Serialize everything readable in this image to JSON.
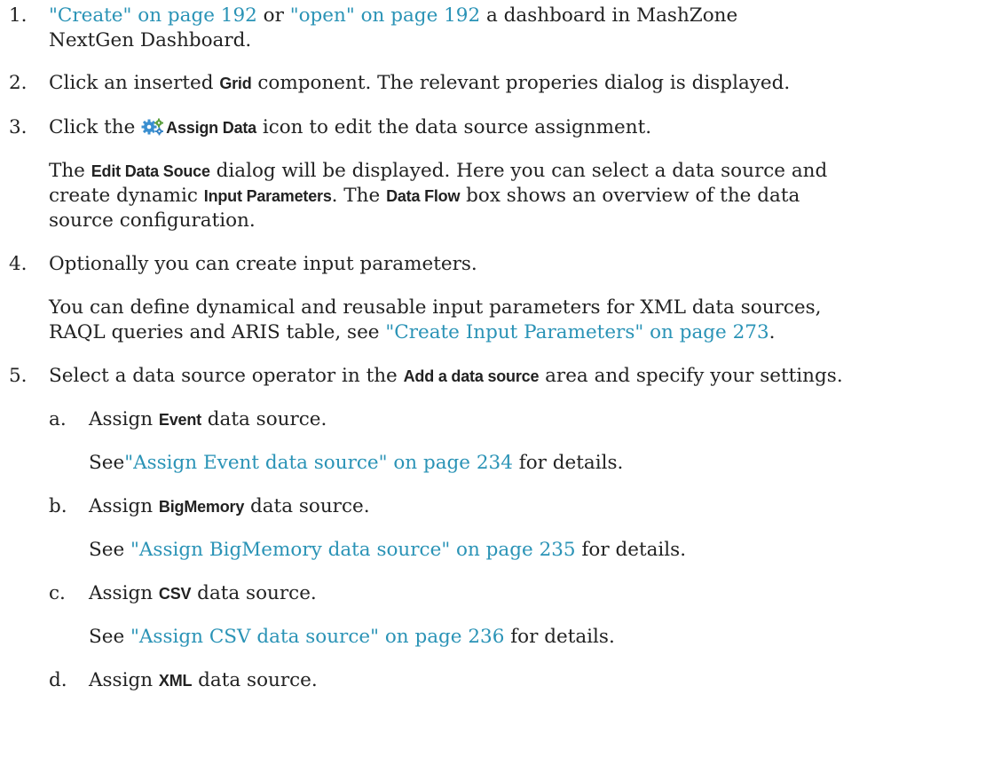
{
  "steps": [
    {
      "num": "1.",
      "create_link": "\"Create\" on page 192",
      "or": " or ",
      "open_link": "\"open\" on page 192",
      "text_end": " a dashboard in MashZone",
      "line2": "NextGen Dashboard."
    },
    {
      "num": "2.",
      "text_start": "Click an inserted ",
      "ui": "Grid",
      "text_end": " component. The relevant properies dialog is displayed."
    },
    {
      "num": "3.",
      "text_start": "Click the ",
      "icon_name": "assign-data-gear-icon",
      "ui": "Assign Data",
      "text_end": " icon to edit the data source assignment.",
      "para": {
        "l1_a": "The ",
        "l1_ui": "Edit Data Souce",
        "l1_b": " dialog will be displayed. Here you can select a data source and",
        "l2_a": "create dynamic ",
        "l2_ui1": "Input Parameters",
        "l2_b": ". The ",
        "l2_ui2": "Data Flow",
        "l2_c": " box shows an overview of the data",
        "l3": "source configuration."
      }
    },
    {
      "num": "4.",
      "text": "Optionally you can create input parameters.",
      "para": {
        "l1": "You can define dynamical and reusable input parameters for XML data sources,",
        "l2_a": "RAQL queries and ARIS table, see ",
        "l2_link": "\"Create Input Parameters\" on page 273",
        "l2_b": "."
      }
    },
    {
      "num": "5.",
      "text_start": "Select a data source operator in the ",
      "ui": "Add a data source",
      "text_end": " area and specify your settings."
    }
  ],
  "substeps": [
    {
      "letter": "a.",
      "text_start": "Assign ",
      "ui": "Event",
      "text_end": " data source.",
      "see": "See",
      "link": "\"Assign Event data source\" on page 234",
      "details": " for details."
    },
    {
      "letter": "b.",
      "text_start": "Assign ",
      "ui": "BigMemory",
      "text_end": " data source.",
      "see": "See ",
      "link": "\"Assign BigMemory data source\" on page 235",
      "details": " for details."
    },
    {
      "letter": "c.",
      "text_start": "Assign ",
      "ui": "CSV",
      "text_end": " data source.",
      "see": "See ",
      "link": "\"Assign CSV data source\" on page 236",
      "details": " for details."
    },
    {
      "letter": "d.",
      "text_start": "Assign ",
      "ui": "XML",
      "text_end": " data source."
    }
  ],
  "colors": {
    "link": "#2a93b6",
    "text": "#222222",
    "icon": "#3a8fd0"
  }
}
